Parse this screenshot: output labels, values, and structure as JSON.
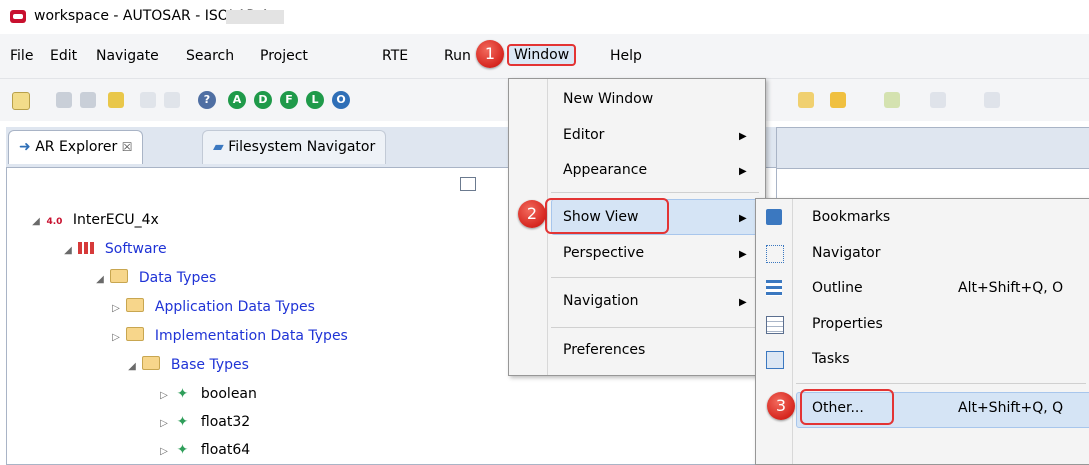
{
  "window": {
    "title": "workspace - AUTOSAR - ISOLAR-A"
  },
  "menubar": [
    "File",
    "Edit",
    "Navigate",
    "Search",
    "Project",
    "RTE",
    "Run",
    "Window",
    "Help"
  ],
  "toolbar": {
    "circles": [
      "A",
      "D",
      "F",
      "L",
      "O"
    ],
    "circle_colors": [
      "#1f9a4a",
      "#1f9a4a",
      "#1f9a4a",
      "#1f9a4a",
      "#2f6fb7"
    ]
  },
  "tabs": {
    "explorer": "AR Explorer",
    "explorer_close": "☒",
    "filesystem": "Filesystem Navigator"
  },
  "tree": {
    "root": "InterECU_4x",
    "root_badge": "4.0",
    "software": "Software",
    "data_types": "Data Types",
    "app_types": "Application Data Types",
    "impl_types": "Implementation Data Types",
    "base_types": "Base Types",
    "items": [
      "boolean",
      "float32",
      "float64"
    ]
  },
  "window_menu": {
    "items": [
      "New Window",
      "Editor",
      "Appearance",
      "Show View",
      "Perspective",
      "Navigation",
      "Preferences"
    ]
  },
  "show_view_menu": {
    "items": [
      {
        "label": "Bookmarks",
        "shortcut": ""
      },
      {
        "label": "Navigator",
        "shortcut": ""
      },
      {
        "label": "Outline",
        "shortcut": "Alt+Shift+Q, O"
      },
      {
        "label": "Properties",
        "shortcut": ""
      },
      {
        "label": "Tasks",
        "shortcut": ""
      },
      {
        "label": "Other...",
        "shortcut": "Alt+Shift+Q, Q"
      }
    ]
  },
  "badges": [
    "1",
    "2",
    "3"
  ],
  "accent": "#e33434"
}
